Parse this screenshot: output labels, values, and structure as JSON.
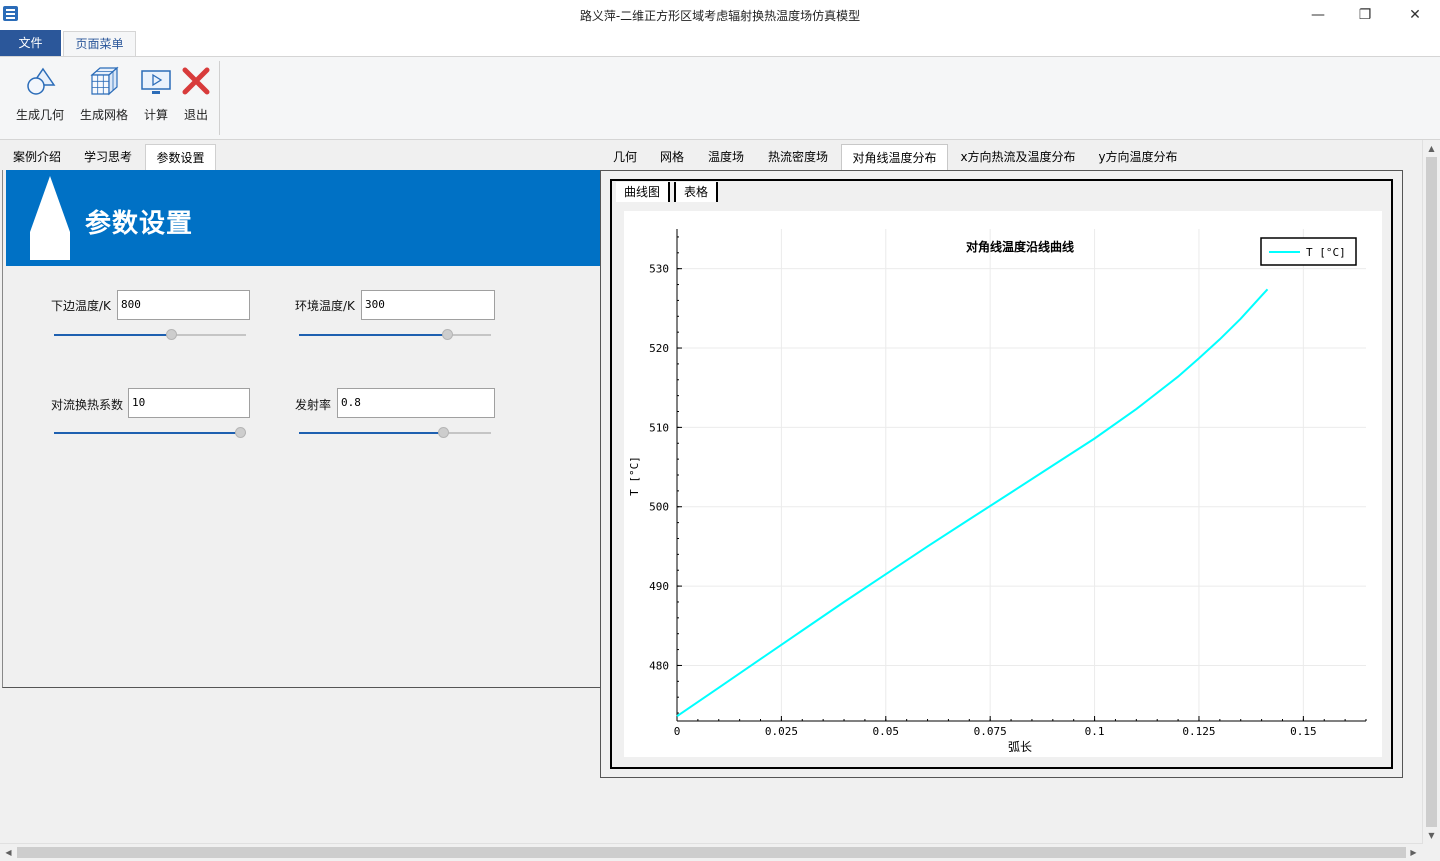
{
  "window": {
    "title": "路义萍-二维正方形区域考虑辐射换热温度场仿真模型",
    "minimize": "—",
    "maximize": "❐",
    "close": "✕"
  },
  "ribbon": {
    "file_tab": "文件",
    "page_tab": "页面菜单",
    "buttons": {
      "geometry": "生成几何",
      "mesh": "生成网格",
      "compute": "计算",
      "exit": "退出"
    }
  },
  "left_tabs": [
    "案例介绍",
    "学习思考",
    "参数设置"
  ],
  "banner": {
    "title": "参数设置"
  },
  "params": {
    "bottom_temp": {
      "label": "下边温度/K",
      "value": "800",
      "slider": 0.62
    },
    "ambient_temp": {
      "label": "环境温度/K",
      "value": "300",
      "slider": 0.79
    },
    "convection": {
      "label": "对流换热系数",
      "value": "10",
      "slider": 1.0
    },
    "emissivity": {
      "label": "发射率",
      "value": "0.8",
      "slider": 0.77
    }
  },
  "right_tabs": [
    "几何",
    "网格",
    "温度场",
    "热流密度场",
    "对角线温度分布",
    "x方向热流及温度分布",
    "y方向温度分布"
  ],
  "sub_tabs": [
    "曲线图",
    "表格"
  ],
  "colors": {
    "accent": "#2b579a",
    "banner": "#0071c5",
    "curve": "#00ffff"
  },
  "chart_data": {
    "type": "line",
    "title": "对角线温度沿线曲线",
    "xlabel": "弧长",
    "ylabel": "T [°C]",
    "xlim": [
      0,
      0.165
    ],
    "ylim": [
      473,
      535
    ],
    "xticks": [
      0,
      0.025,
      0.05,
      0.075,
      0.1,
      0.125,
      0.15
    ],
    "xtick_labels": [
      "0",
      "0.025",
      "0.05",
      "0.075",
      "0.1",
      "0.125",
      "0.15"
    ],
    "yticks": [
      480,
      490,
      500,
      510,
      520,
      530
    ],
    "legend_position": "top-right",
    "grid": true,
    "series": [
      {
        "name": "T [°C]",
        "x": [
          0,
          0.01,
          0.02,
          0.03,
          0.04,
          0.05,
          0.06,
          0.07,
          0.08,
          0.09,
          0.1,
          0.11,
          0.12,
          0.125,
          0.13,
          0.135,
          0.14,
          0.1414
        ],
        "y": [
          473.6,
          477.2,
          480.8,
          484.4,
          488.0,
          491.5,
          495.0,
          498.4,
          501.8,
          505.2,
          508.6,
          512.3,
          516.4,
          518.7,
          521.1,
          523.7,
          526.6,
          527.4
        ]
      }
    ]
  }
}
